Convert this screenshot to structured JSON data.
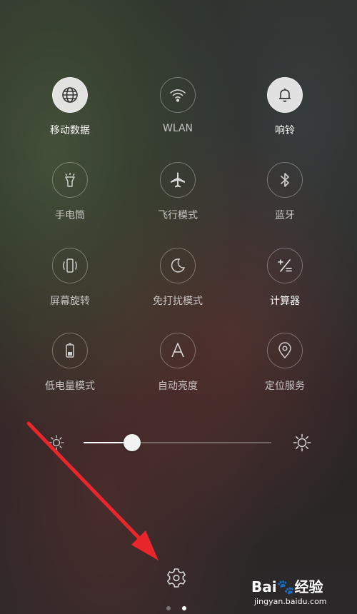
{
  "tiles": [
    {
      "id": "mobile-data",
      "label": "移动数据",
      "icon": "globe-icon",
      "active": true
    },
    {
      "id": "wlan",
      "label": "WLAN",
      "icon": "wifi-icon",
      "active": false
    },
    {
      "id": "ringer",
      "label": "响铃",
      "icon": "bell-icon",
      "active": true
    },
    {
      "id": "flashlight",
      "label": "手电筒",
      "icon": "flashlight-icon",
      "active": false
    },
    {
      "id": "airplane",
      "label": "飞行模式",
      "icon": "airplane-icon",
      "active": false
    },
    {
      "id": "bluetooth",
      "label": "蓝牙",
      "icon": "bluetooth-icon",
      "active": false
    },
    {
      "id": "rotation",
      "label": "屏幕旋转",
      "icon": "rotate-icon",
      "active": false
    },
    {
      "id": "dnd",
      "label": "免打扰模式",
      "icon": "moon-icon",
      "active": false
    },
    {
      "id": "calculator",
      "label": "计算器",
      "icon": "calculator-icon",
      "active": false
    },
    {
      "id": "battery-saver",
      "label": "低电量模式",
      "icon": "battery-icon",
      "active": false
    },
    {
      "id": "auto-brightness",
      "label": "自动亮度",
      "icon": "letter-a-icon",
      "active": false
    },
    {
      "id": "location",
      "label": "定位服务",
      "icon": "location-pin-icon",
      "active": false
    }
  ],
  "brightness": {
    "level": 0.26,
    "low_icon": "sun-small-icon",
    "high_icon": "sun-large-icon"
  },
  "settings_icon": "gear-icon",
  "page_indicator": {
    "count": 2,
    "current": 2
  },
  "annotation_arrow_color": "#e8262b",
  "watermark": {
    "brand": "Bai",
    "brand_suffix": "经验",
    "url": "jingyan.baidu.com"
  }
}
